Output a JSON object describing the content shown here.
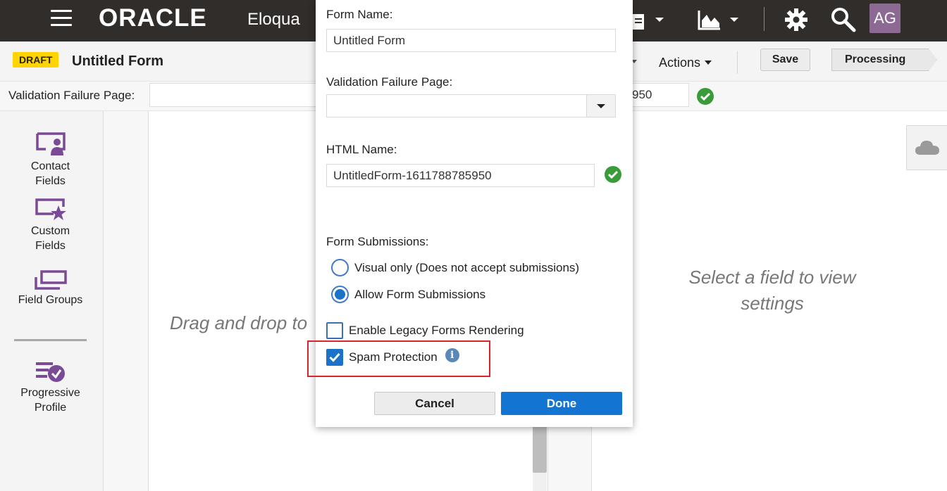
{
  "topbar": {
    "logo": "ORACLE",
    "product": "Eloqua",
    "avatar_initials": "AG",
    "icons": [
      "menu-icon",
      "document-icon",
      "chart-icon",
      "gear-icon",
      "search-icon"
    ]
  },
  "header": {
    "status_badge": "DRAFT",
    "form_title": "Untitled Form",
    "actions_label": "Actions",
    "save_label": "Save",
    "processing_label": "Processing"
  },
  "validation_row": {
    "label": "Validation Failure Page:",
    "html_name_partial": "950"
  },
  "sidebar": {
    "items": [
      {
        "label_line1": "Contact",
        "label_line2": "Fields",
        "icon": "contact-fields-icon"
      },
      {
        "label_line1": "Custom",
        "label_line2": "Fields",
        "icon": "custom-fields-icon"
      },
      {
        "label_line1": "Field Groups",
        "label_line2": "",
        "icon": "field-groups-icon"
      },
      {
        "label_line1": "Progressive",
        "label_line2": "Profile",
        "icon": "progressive-profile-icon"
      }
    ]
  },
  "canvas": {
    "placeholder": "Drag and drop to"
  },
  "settings": {
    "placeholder_line1": "Select a field to view",
    "placeholder_line2": "settings",
    "icon": "cloud-icon"
  },
  "modal": {
    "form_name_label": "Form Name:",
    "form_name_value": "Untitled Form",
    "validation_label": "Validation Failure Page:",
    "validation_value": "",
    "html_name_label": "HTML Name:",
    "html_name_value": "UntitledForm-1611788785950",
    "submissions_label": "Form Submissions:",
    "radio_visual_only": "Visual only (Does not accept submissions)",
    "radio_allow": "Allow Form Submissions",
    "radio_selected": "Allow Form Submissions",
    "legacy_label": "Enable Legacy Forms Rendering",
    "legacy_checked": false,
    "spam_label": "Spam Protection",
    "spam_checked": true,
    "info_glyph": "i",
    "cancel_label": "Cancel",
    "done_label": "Done"
  },
  "colors": {
    "topbar": "#312d2a",
    "draft_badge": "#ffd400",
    "primary_button": "#1474d1",
    "highlight_border": "#d9262e",
    "success": "#3a9b3a",
    "icon_purple": "#7b4a97"
  }
}
